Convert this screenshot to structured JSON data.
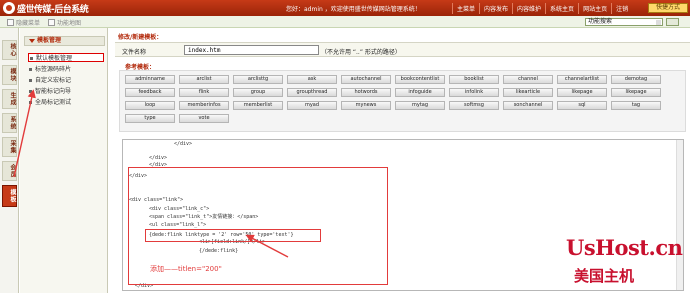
{
  "topbar": {
    "logo_text": "盛世传媒-后台系统",
    "welcome": "您好：admin ，欢迎使用盛世传媒网站管理系统！",
    "nav": [
      "主菜单",
      "内容发布",
      "内容维护",
      "系统主页",
      "网站主页",
      "注销"
    ],
    "quick_button": "快捷方式"
  },
  "subbar": {
    "item1": "隐藏菜单",
    "item2": "功能地图",
    "function_select": "功能搜索"
  },
  "lefttabs": [
    "核心",
    "模块",
    "生成",
    "系统",
    "采集",
    "会员",
    "模板"
  ],
  "leftmenu": {
    "heading": "模板管理",
    "items": [
      "默认模板管理",
      "标签源码碎片",
      "自定义宏标记",
      "智能标记向导",
      "全局标记测试"
    ]
  },
  "main": {
    "page_title": "修改/新建模板：",
    "file_label": "文件名称",
    "file_value": "index.htm",
    "file_hint": "（不允许用 “..” 形式的路径）",
    "ref_title": "参考模板：",
    "tags": [
      "adminname",
      "arclist",
      "arclisttg",
      "ask",
      "autochannel",
      "bookcontentlist",
      "booklist",
      "channel",
      "channelartlist",
      "demotag",
      "feedback",
      "flink",
      "group",
      "groupthread",
      "hotwords",
      "infoguide",
      "infolink",
      "likearticle",
      "likepage",
      "likepage",
      "loop",
      "memberinfos",
      "memberlist",
      "myad",
      "mynews",
      "mytag",
      "softmsg",
      "sonchannel",
      "sql",
      "tag",
      "type",
      "vote"
    ],
    "code": {
      "l1": "</div>",
      "l2": "</div>",
      "l3": "</div>",
      "l4": "</div>",
      "l5": "<div class=\"link\">",
      "l6": "<div class=\"link_c\">",
      "l7": "<span class=\"link_t\">友情链接：</span>",
      "l8": "<ul class=\"link_l\">",
      "l9": "{dede:flink linktype = '2' row='50' type='text'}",
      "l10": "<li>[field:link/]</li>",
      "l11": "{/dede:flink}",
      "l12": "</div>"
    },
    "annotation": "添加——titlen=\"200\""
  },
  "watermark": {
    "line1": "UsHost.cn",
    "line2": "美国主机"
  }
}
